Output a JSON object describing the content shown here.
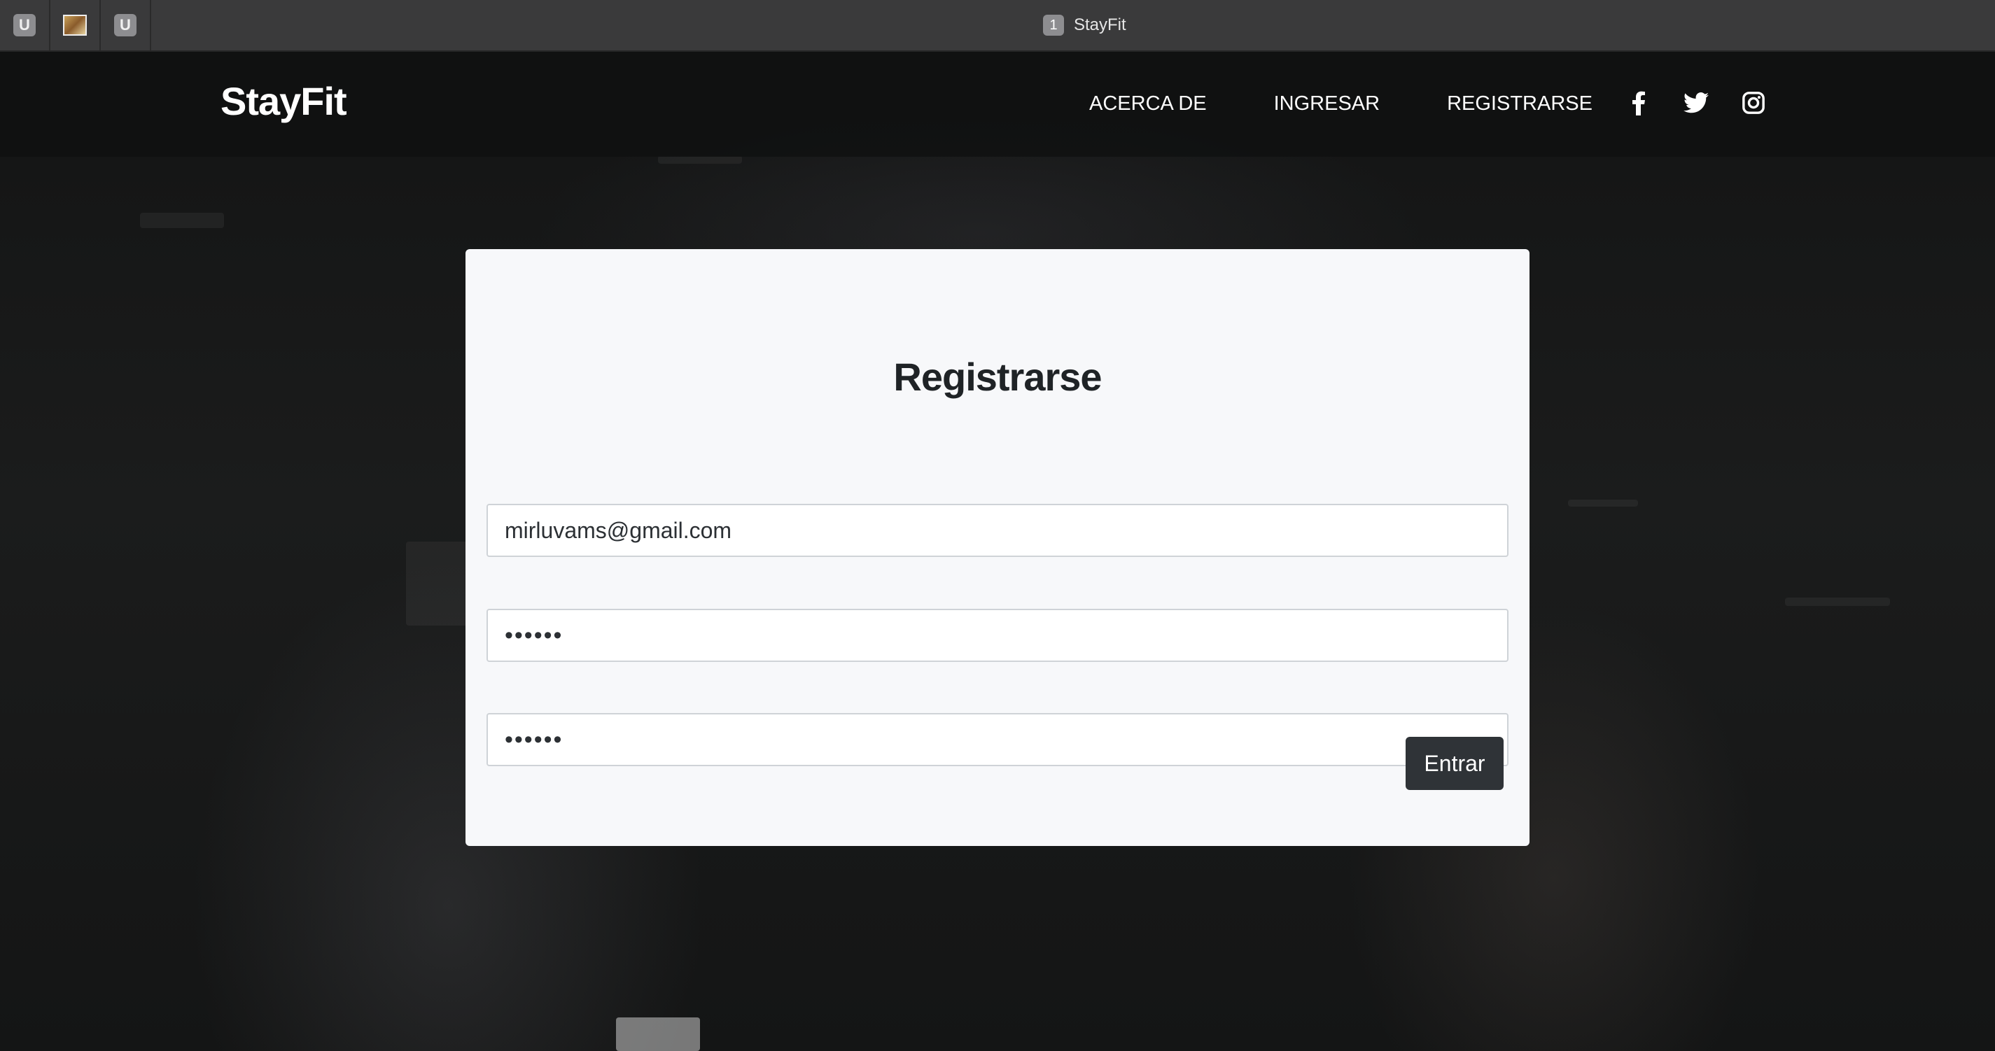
{
  "browser": {
    "tab_icons": [
      "U",
      "image",
      "U"
    ],
    "window_title_number": "1",
    "window_title": "StayFit"
  },
  "navbar": {
    "brand": "StayFit",
    "links": [
      "ACERCA DE",
      "INGRESAR",
      "REGISTRARSE"
    ],
    "social_icons": [
      "facebook-icon",
      "twitter-icon",
      "instagram-icon"
    ]
  },
  "form": {
    "title": "Registrarse",
    "email_value": "mirluvams@gmail.com",
    "password_value": "••••••",
    "confirm_password_value": "••••••",
    "submit_label": "Entrar"
  },
  "colors": {
    "navbar_bg": "#101111",
    "card_bg": "#f7f8fa",
    "button_bg": "#2f3337"
  }
}
